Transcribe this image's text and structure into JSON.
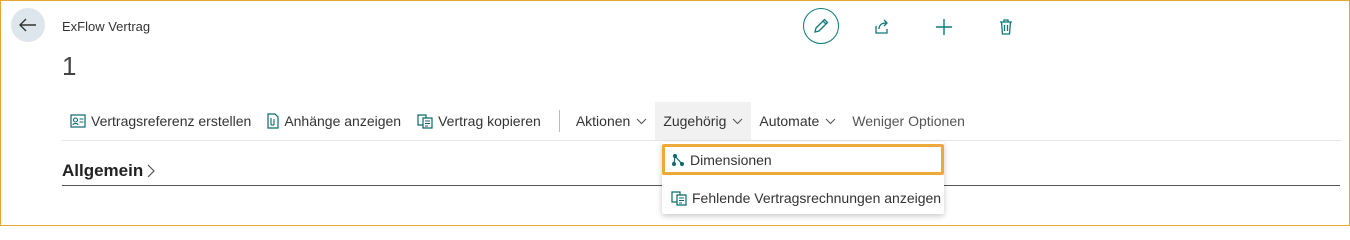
{
  "header": {
    "caption": "ExFlow Vertrag",
    "record_no": "1"
  },
  "top_actions": [
    "edit-icon",
    "share-icon",
    "add-icon",
    "delete-icon"
  ],
  "commandbar": {
    "create_reference": "Vertragsreferenz erstellen",
    "show_attachments": "Anhänge anzeigen",
    "copy_contract": "Vertrag kopieren",
    "actions": "Aktionen",
    "related": "Zugehörig",
    "automate": "Automate",
    "fewer_options": "Weniger Optionen"
  },
  "dropdown": {
    "items": [
      {
        "label": "Dimensionen",
        "icon": "dimensions-icon",
        "highlighted": true
      },
      {
        "label": "Fehlende Vertragsrechnungen anzeigen",
        "icon": "document-icon",
        "highlighted": false
      }
    ]
  },
  "section": {
    "title": "Allgemein"
  },
  "colors": {
    "accent": "#0b7a7a",
    "highlight_border": "#eda93a",
    "frame_border": "#e8a530"
  }
}
